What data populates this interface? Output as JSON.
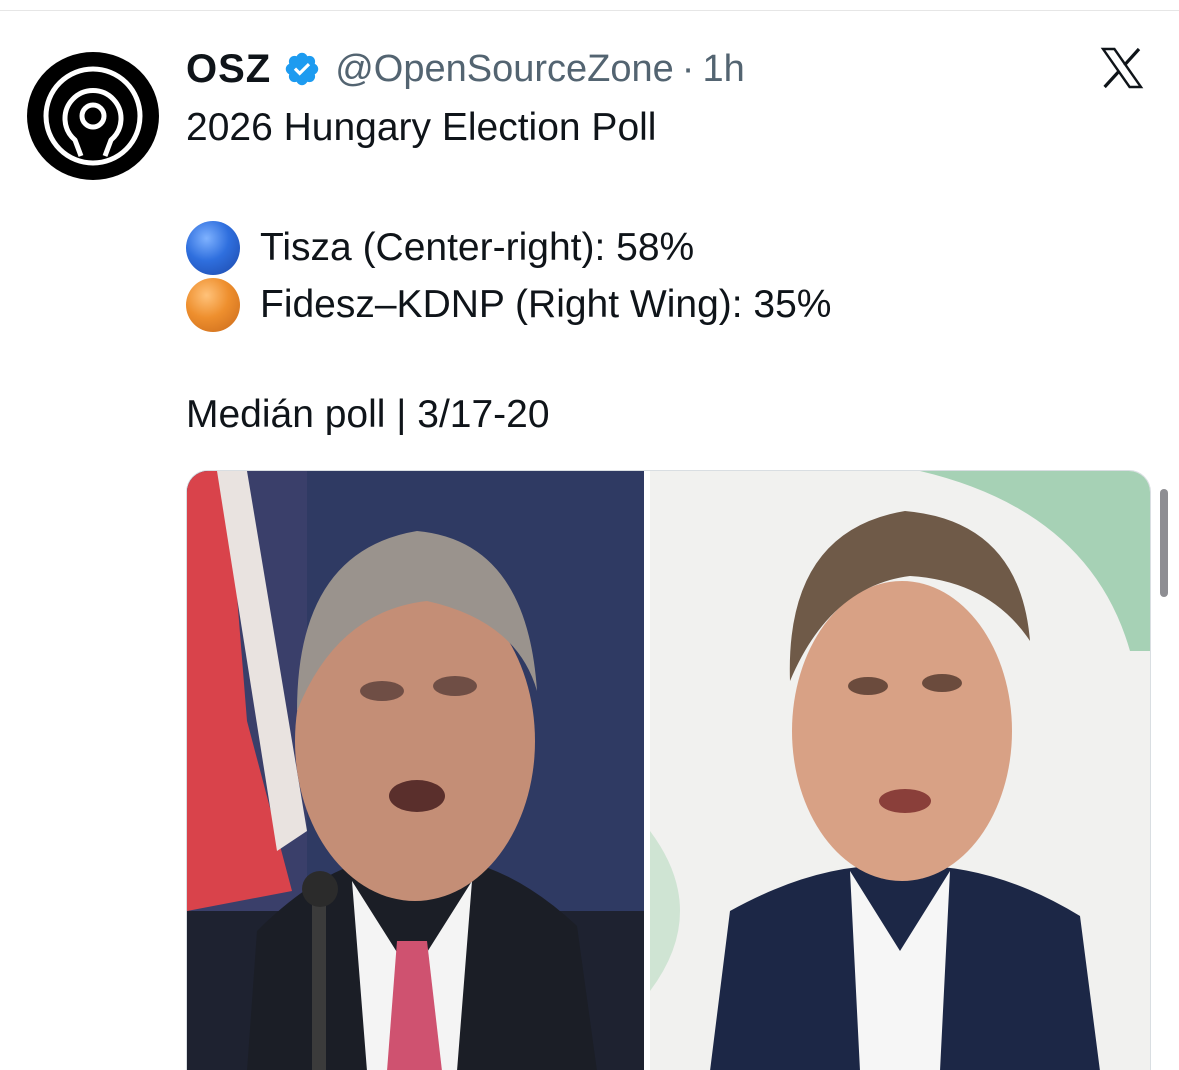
{
  "tweet": {
    "display_name": "OSZ",
    "handle": "@OpenSourceZone",
    "separator": "·",
    "time": "1h",
    "title": "2026 Hungary Election Poll",
    "lines": [
      {
        "marker_color": "#2f6fde",
        "text": "Tisza (Center-right): 58%"
      },
      {
        "marker_color": "#ee8f2e",
        "text": "Fidesz–KDNP (Right Wing): 35%"
      }
    ],
    "source": "Medián poll | 3/17-20"
  },
  "icons": {
    "avatar": "open-source-keyhole-logo",
    "verified": "verified-badge-icon",
    "platform": "x-logo-icon"
  },
  "colors": {
    "verified_blue": "#1d9bf0",
    "secondary_text": "#536471",
    "primary_text": "#0f1419"
  }
}
